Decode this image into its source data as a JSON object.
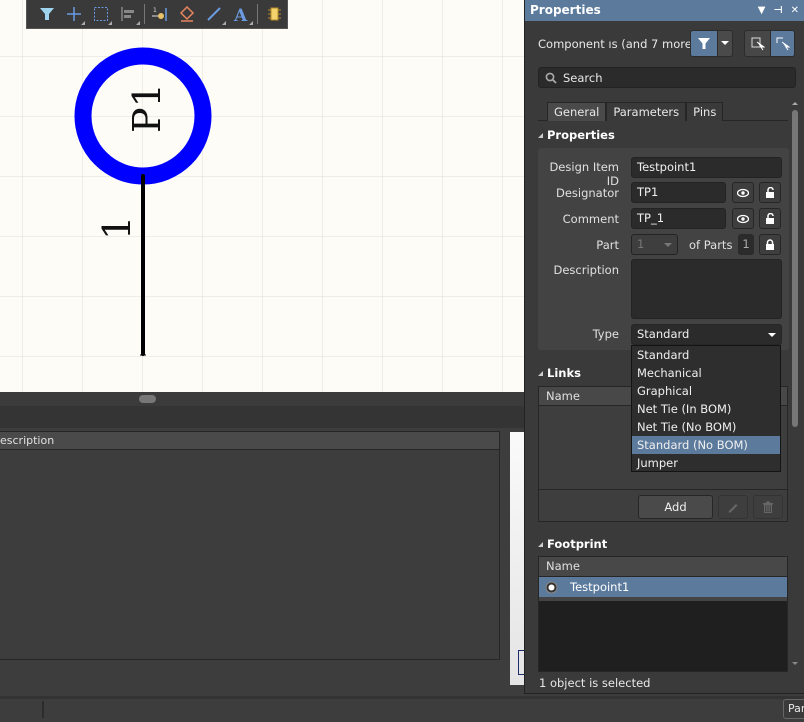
{
  "toolbar": {
    "icons": [
      "filter-icon",
      "crosshair-icon",
      "select-rect-icon",
      "align-icon",
      "place-pin-icon",
      "erase-icon",
      "line-icon",
      "text-icon",
      "component-icon"
    ]
  },
  "canvas": {
    "component_designator": "P1",
    "pin_number": "1",
    "accent_color": "#0000ff"
  },
  "bottom_panel": {
    "column_header": "escription"
  },
  "statusbar": {
    "panels_button": "Panels"
  },
  "properties": {
    "title": "Properties",
    "title_controls": [
      "▼",
      "⊣",
      "✕"
    ],
    "selection_label": "Component   ıs (and 7 more)",
    "search_placeholder": "Search",
    "tabs": [
      {
        "label": "General",
        "active": true
      },
      {
        "label": "Parameters",
        "active": false
      },
      {
        "label": "Pins",
        "active": false
      }
    ],
    "section_properties": "Properties",
    "fields": {
      "design_item_id_label": "Design Item ID",
      "design_item_id_value": "Testpoint1",
      "designator_label": "Designator",
      "designator_value": "TP1",
      "comment_label": "Comment",
      "comment_value": "TP_1",
      "part_label": "Part",
      "part_value": "1",
      "of_parts_label": "of Parts",
      "of_parts_value": "1",
      "description_label": "Description",
      "description_value": "",
      "type_label": "Type",
      "type_value": "Standard"
    },
    "type_options": [
      {
        "label": "Standard",
        "highlighted": false
      },
      {
        "label": "Mechanical",
        "highlighted": false
      },
      {
        "label": "Graphical",
        "highlighted": false
      },
      {
        "label": "Net Tie (In BOM)",
        "highlighted": false
      },
      {
        "label": "Net Tie (No BOM)",
        "highlighted": false
      },
      {
        "label": "Standard (No BOM)",
        "highlighted": true
      },
      {
        "label": "Jumper",
        "highlighted": false
      }
    ],
    "section_links": "Links",
    "links_column": "Name",
    "add_button": "Add",
    "section_footprint": "Footprint",
    "footprint_column": "Name",
    "footprint_items": [
      {
        "name": "Testpoint1",
        "selected": true
      }
    ],
    "status": "1 object is selected",
    "accent_color": "#5b7a9c"
  }
}
